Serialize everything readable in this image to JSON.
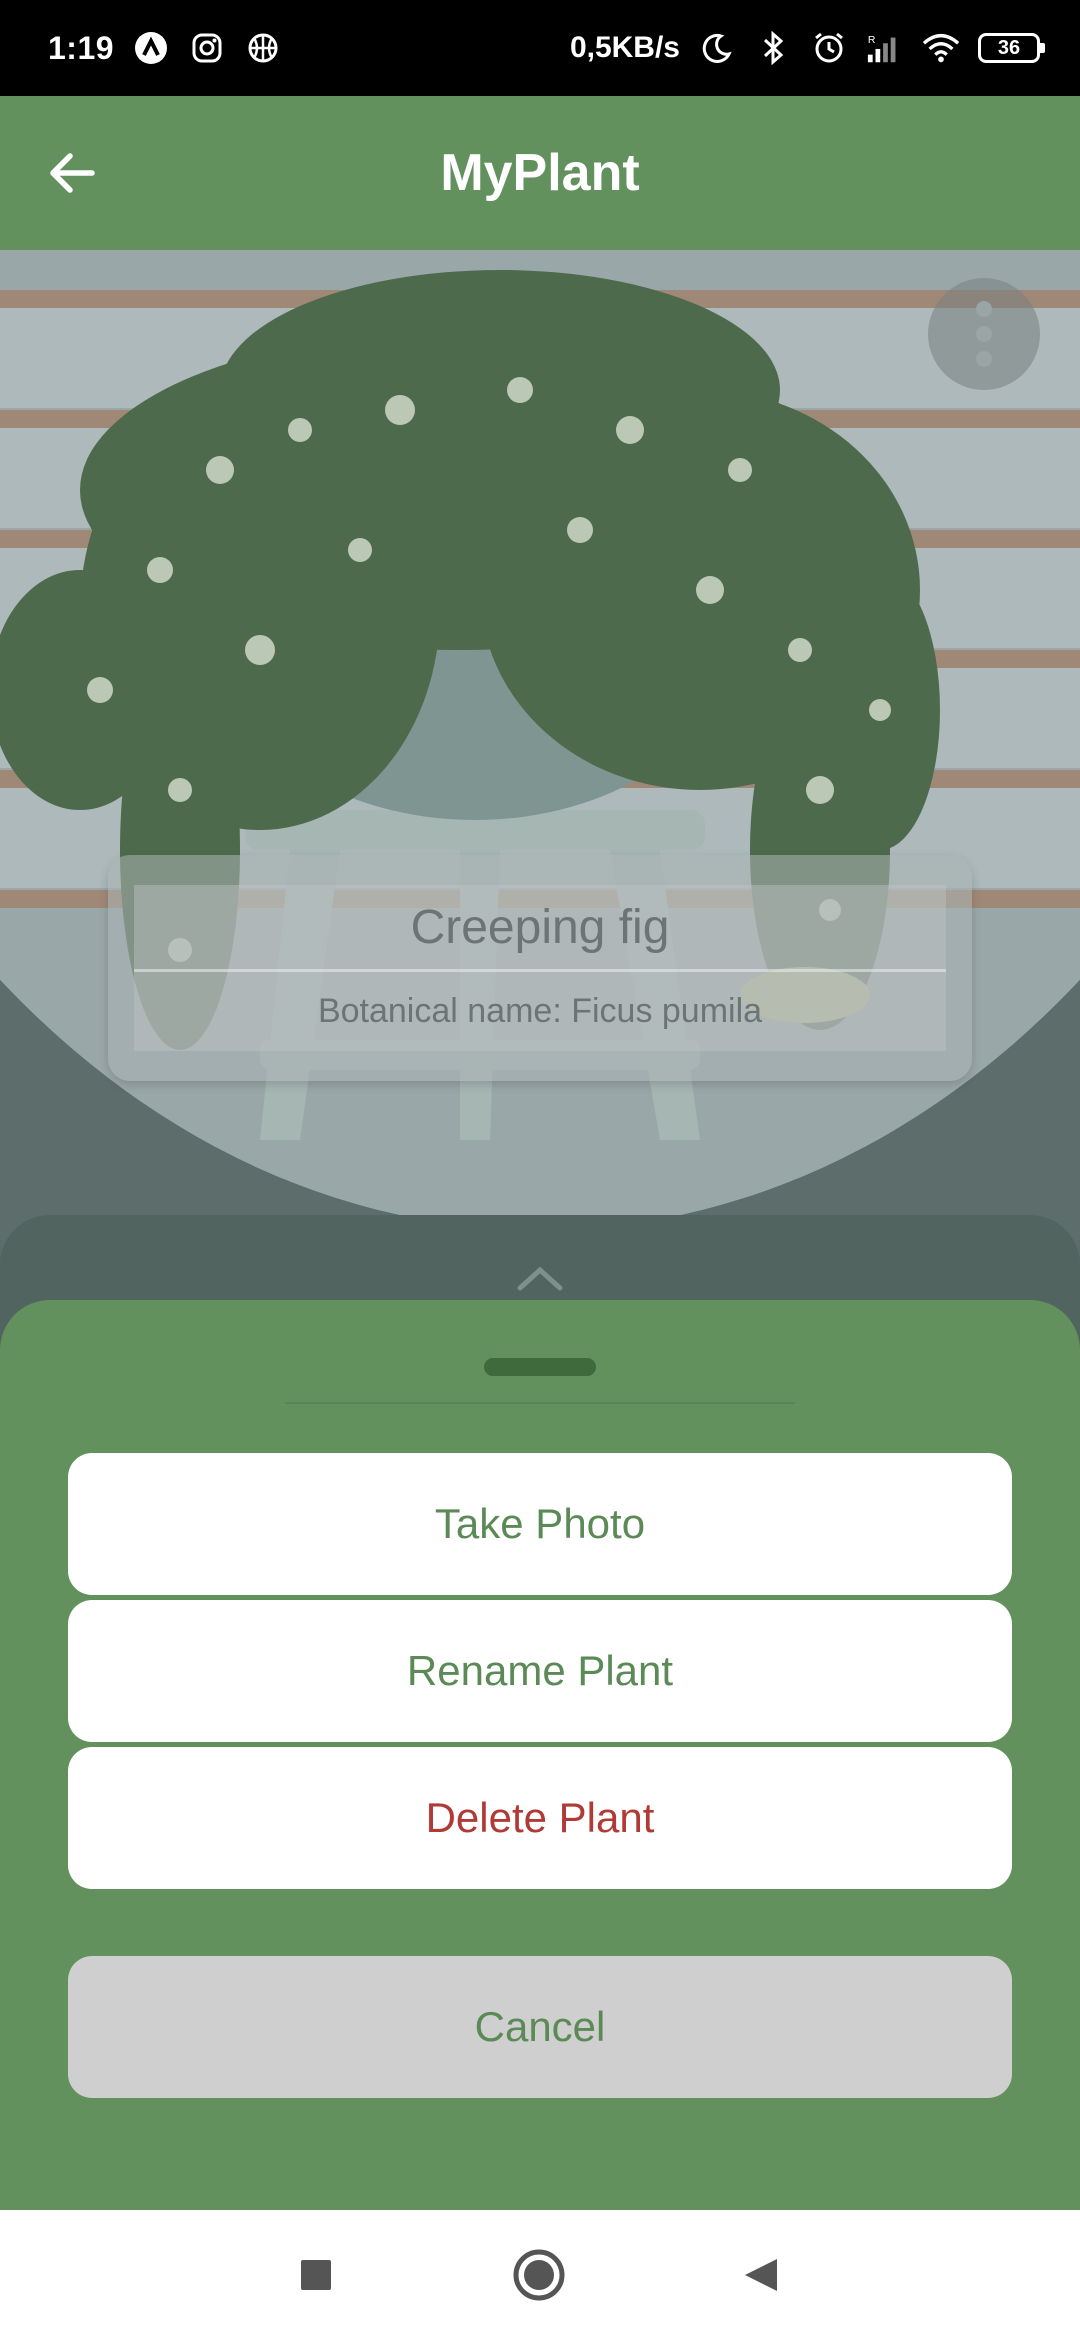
{
  "status_bar": {
    "time": "1:19",
    "speed": "0,5KB/s",
    "battery": "36",
    "icons": [
      "a-icon",
      "instagram-icon",
      "basketball-icon",
      "moon-icon",
      "bluetooth-icon",
      "alarm-icon",
      "signal-icon",
      "wifi-icon",
      "battery-icon"
    ]
  },
  "appbar": {
    "title": "MyPlant",
    "back_icon": "arrow-left-icon"
  },
  "plant": {
    "name": "Creeping fig",
    "botanical": "Botanical name: Ficus pumila"
  },
  "sheet": {
    "take_photo": "Take Photo",
    "rename": "Rename Plant",
    "delete": "Delete Plant",
    "cancel": "Cancel"
  },
  "colors": {
    "accent_green": "#62915e",
    "delete_red": "#b23a36",
    "cancel_gray": "#cfcfcf"
  },
  "navbar": {
    "icons": [
      "recents-square-icon",
      "home-circle-icon",
      "back-triangle-icon"
    ]
  }
}
